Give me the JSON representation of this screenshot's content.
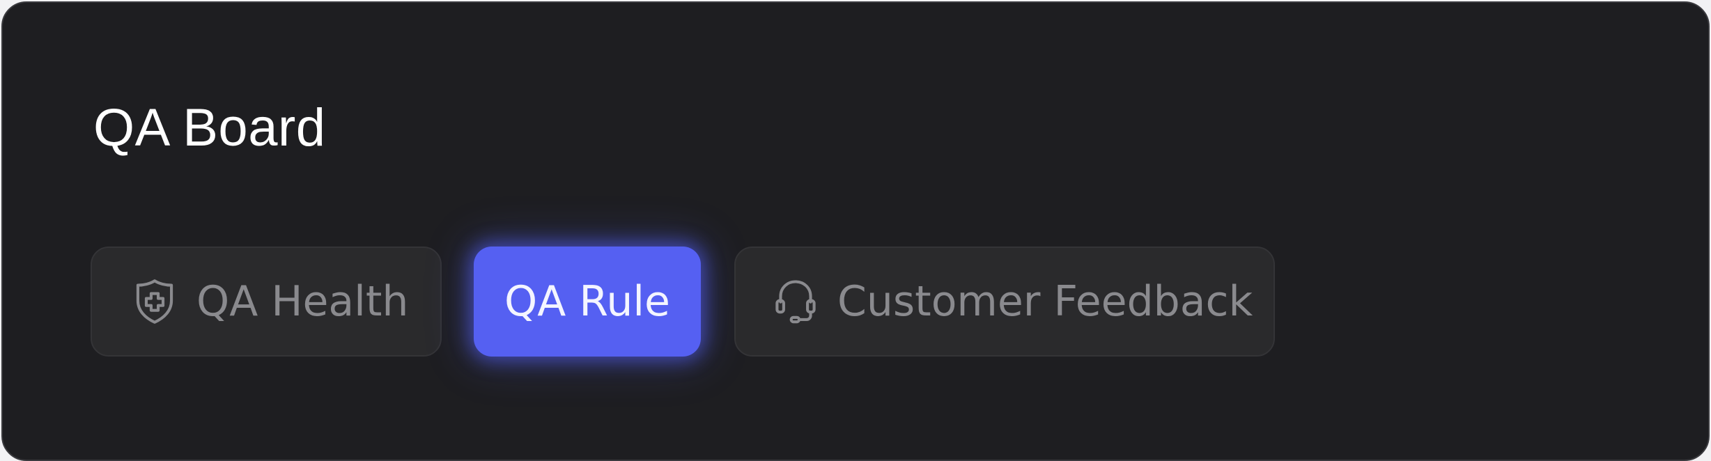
{
  "board": {
    "title": "QA Board"
  },
  "tabs": [
    {
      "label": "QA Health",
      "icon": "shield-plus-icon",
      "active": false
    },
    {
      "label": "QA Rule",
      "icon": "",
      "active": true
    },
    {
      "label": "Customer Feedback",
      "icon": "headset-icon",
      "active": false
    }
  ],
  "colors": {
    "background": "#1e1e21",
    "tab_inactive": "#2a2a2c",
    "tab_active": "#5560f2",
    "text_muted": "#8a8a8e",
    "text_primary": "#ffffff"
  }
}
